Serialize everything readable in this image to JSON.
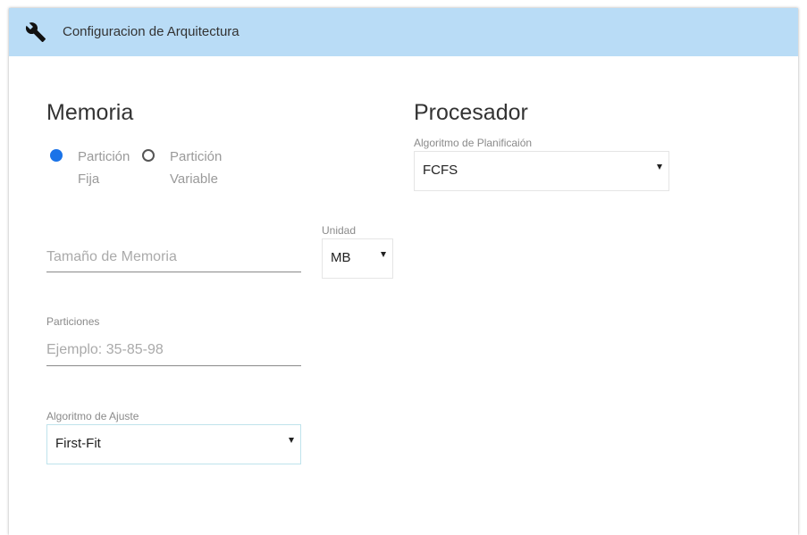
{
  "header": {
    "title": "Configuracion de Arquitectura",
    "icon": "wrench-icon"
  },
  "memoria": {
    "title": "Memoria",
    "radio_fija": {
      "line1": "Partición",
      "line2": "Fija",
      "selected": true
    },
    "radio_variable": {
      "line1": "Partición",
      "line2": "Variable",
      "selected": false
    },
    "tamano": {
      "placeholder": "Tamaño de Memoria",
      "value": ""
    },
    "unidad": {
      "label": "Unidad",
      "value": "MB"
    },
    "particiones": {
      "label": "Particiones",
      "placeholder": "Ejemplo: 35-85-98",
      "value": ""
    },
    "ajuste": {
      "label": "Algoritmo de Ajuste",
      "value": "First-Fit"
    }
  },
  "procesador": {
    "title": "Procesador",
    "planificacion": {
      "label": "Algoritmo de Planificaión",
      "value": "FCFS"
    }
  },
  "colors": {
    "header_bg": "#b9dcf6",
    "accent": "#1a73e8",
    "focus_border": "#bfe3ec"
  }
}
